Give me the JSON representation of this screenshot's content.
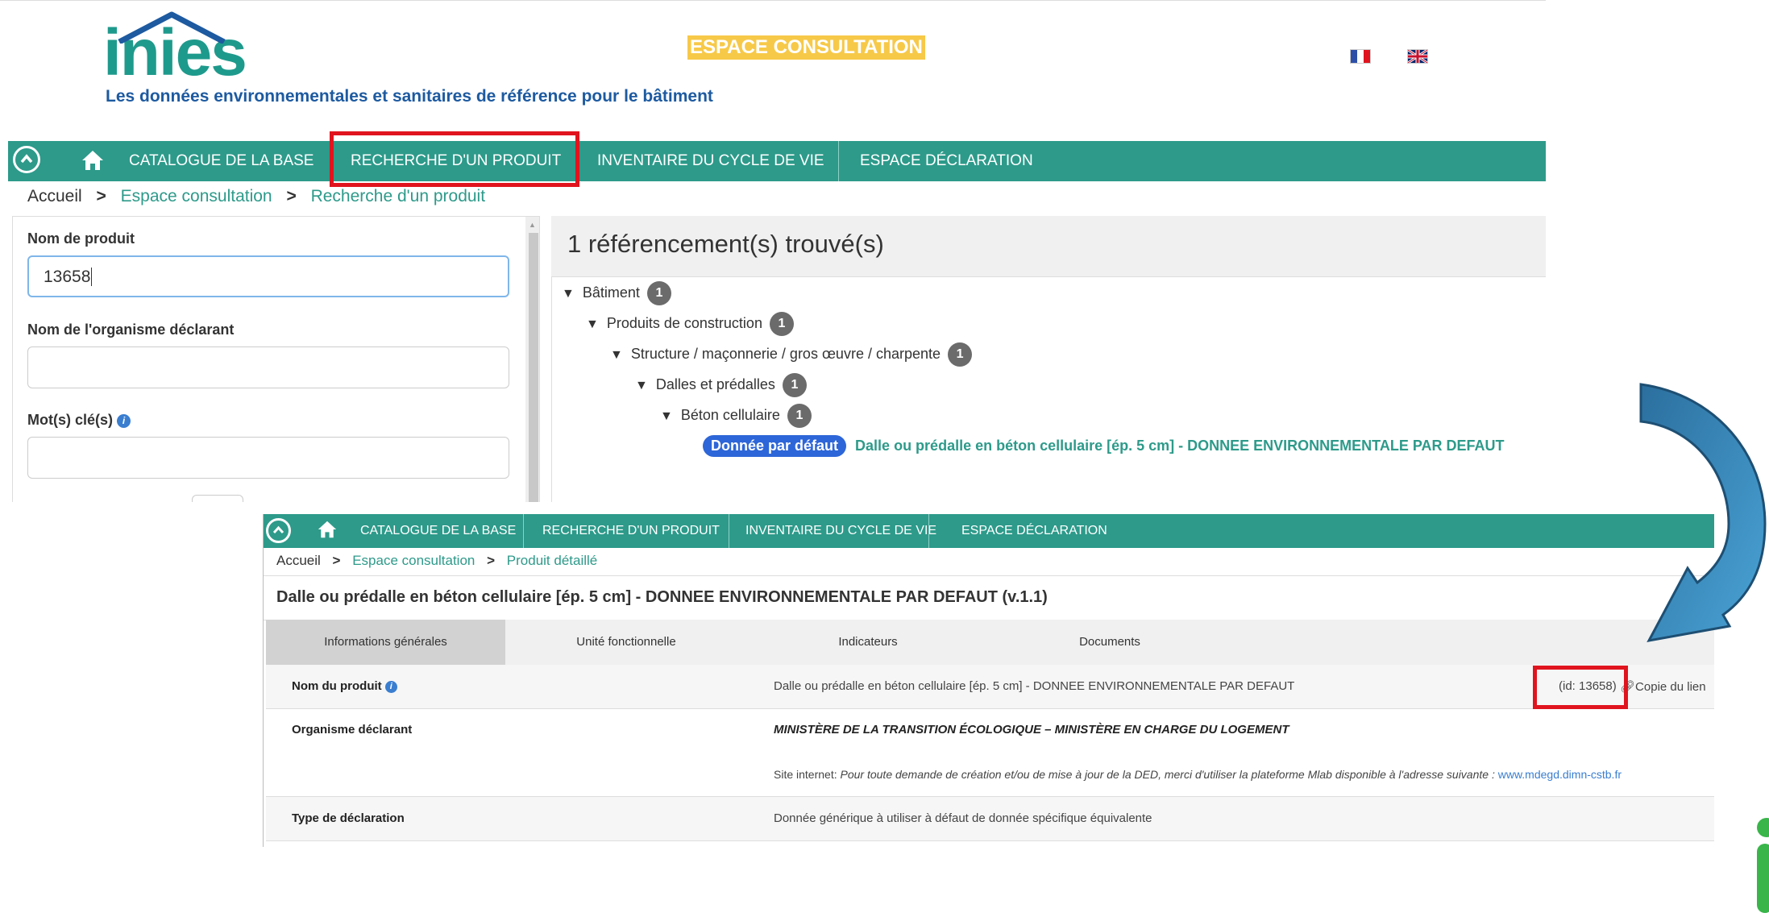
{
  "brand": {
    "logo_text": "inies",
    "tagline": "Les données environnementales et sanitaires de référence pour le bâtiment",
    "espace_label": "ESPACE CONSULTATION",
    "colors": {
      "teal": "#2d9a8a",
      "blue": "#1d5aa0",
      "yellow": "#f7c948",
      "highlight_red": "#e0141e"
    }
  },
  "languages": [
    "fr-flag-icon",
    "en-flag-icon"
  ],
  "nav": {
    "catalogue": "CATALOGUE DE LA BASE",
    "recherche": "RECHERCHE D'UN PRODUIT",
    "inventaire": "INVENTAIRE DU CYCLE DE VIE",
    "declaration": "ESPACE DÉCLARATION"
  },
  "search_page": {
    "breadcrumb": {
      "home": "Accueil",
      "espace": "Espace consultation",
      "current": "Recherche d'un produit",
      "sep": ">"
    },
    "form": {
      "product_name_label": "Nom de produit",
      "product_name_value": "13658",
      "organism_label": "Nom de l'organisme déclarant",
      "organism_value": "",
      "keywords_label": "Mot(s) clé(s)",
      "keywords_value": ""
    },
    "results_title": "1 référencement(s) trouvé(s)",
    "tree": [
      {
        "label": "Bâtiment",
        "count": "1"
      },
      {
        "label": "Produits de construction",
        "count": "1"
      },
      {
        "label": "Structure / maçonnerie / gros œuvre / charpente",
        "count": "1"
      },
      {
        "label": "Dalles et prédalles",
        "count": "1"
      },
      {
        "label": "Béton cellulaire",
        "count": "1"
      }
    ],
    "result": {
      "badge": "Donnée par défaut",
      "name": "Dalle ou prédalle en béton cellulaire [ép. 5 cm] - DONNEE ENVIRONNEMENTALE PAR DEFAUT"
    }
  },
  "detail_page": {
    "breadcrumb": {
      "home": "Accueil",
      "espace": "Espace consultation",
      "current": "Produit détaillé",
      "sep": ">"
    },
    "title": "Dalle ou prédalle en béton cellulaire [ép. 5 cm] - DONNEE ENVIRONNEMENTALE PAR DEFAUT (v.1.1)",
    "tabs": [
      "Informations générales",
      "Unité fonctionnelle",
      "Indicateurs",
      "Documents"
    ],
    "rows": {
      "product_name_key": "Nom du produit",
      "product_name_value": "Dalle ou prédalle en béton cellulaire [ép. 5 cm] - DONNEE ENVIRONNEMENTALE PAR DEFAUT",
      "id_text": "(id: 13658)",
      "copy_link": "Copie du lien",
      "organism_key": "Organisme déclarant",
      "organism_value": "MINISTÈRE DE LA TRANSITION ÉCOLOGIQUE – MINISTÈRE EN CHARGE DU LOGEMENT",
      "website_prefix": "Site internet:",
      "website_note": "Pour toute demande de création et/ou de mise à jour de la DED, merci d'utiliser la plateforme Mlab disponible à l'adresse suivante :",
      "website_url": "www.mdegd.dimn-cstb.fr",
      "decl_type_key": "Type de déclaration",
      "decl_type_value": "Donnée générique à utiliser à défaut de donnée spécifique équivalente"
    }
  }
}
